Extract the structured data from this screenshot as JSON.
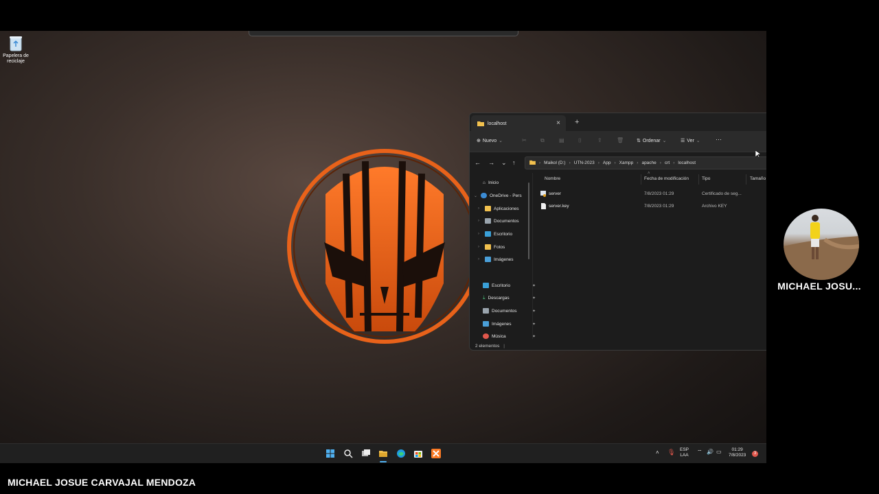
{
  "desktop": {
    "recycle_bin_label_line1": "Papelera de",
    "recycle_bin_label_line2": "reciclaje"
  },
  "explorer": {
    "tab_title": "localhost",
    "new_tab": "+",
    "toolbar": {
      "new_label": "Nuevo",
      "sort_label": "Ordenar",
      "view_label": "Ver",
      "more": "···"
    },
    "breadcrumb": [
      "Maikol (D:)",
      "UTN-2023",
      "App",
      "Xampp",
      "apache",
      "crt",
      "localhost"
    ],
    "sidebar": {
      "home": "Inicio",
      "onedrive": "OneDrive - Pers",
      "tree": [
        "Aplicaciones",
        "Documentos",
        "Escritorio",
        "Fotos",
        "Imágenes"
      ],
      "quick": [
        "Escritorio",
        "Descargas",
        "Documentos",
        "Imágenes",
        "Música"
      ]
    },
    "columns": {
      "name": "Nombre",
      "date": "Fecha de modificación",
      "type": "Tipo",
      "size": "Tamaño"
    },
    "files": [
      {
        "name": "server",
        "date": "7/8/2023 01:29",
        "type": "Certificado de seg..."
      },
      {
        "name": "server.key",
        "date": "7/8/2023 01:29",
        "type": "Archivo KEY"
      }
    ],
    "status": "2 elementos"
  },
  "taskbar": {
    "lang_line1": "ESP",
    "lang_line2": "LAA",
    "time": "01:29",
    "date": "7/8/2023",
    "notification_count": "3"
  },
  "overlay": {
    "webcam_name": "MICHAEL JOSU...",
    "presenter_name": "MICHAEL JOSUE CARVAJAL MENDOZA"
  },
  "colors": {
    "accent_orange": "#e8621a",
    "folder_yellow": "#f2c14e",
    "taskbar_bg": "#202020",
    "explorer_bg": "#1c1c1c"
  }
}
